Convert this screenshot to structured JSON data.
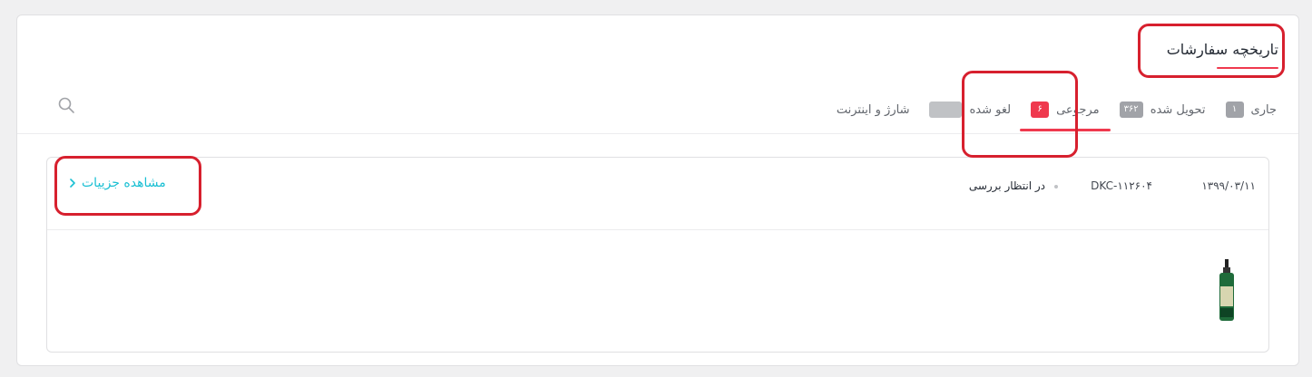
{
  "header": {
    "title": "تاریخچه سفارشات"
  },
  "tabs": [
    {
      "label": "جاری",
      "badge": "۱",
      "badge_color": "#a1a3a8"
    },
    {
      "label": "تحویل شده",
      "badge": "۳۶۲",
      "badge_color": "#a1a3a8"
    },
    {
      "label": "مرجوعی",
      "badge": "۶",
      "badge_color": "#ef394e",
      "active": true
    },
    {
      "label": "لغو شده",
      "badge": "",
      "badge_color": "#c0c2c5"
    },
    {
      "label": "شارژ و اینترنت"
    }
  ],
  "search": {
    "icon": "search-icon"
  },
  "order": {
    "date": "۱۳۹۹/۰۳/۱۱",
    "code": "DKC-۱۱۲۶۰۴",
    "status": "در انتظار بررسی",
    "details_label": "مشاهده جزییات",
    "details_icon": "chevron-left-icon",
    "product_icon": "product-bottle-image"
  },
  "colors": {
    "accent": "#ef394e",
    "link": "#19bfd3",
    "highlight": "#d7202e"
  }
}
